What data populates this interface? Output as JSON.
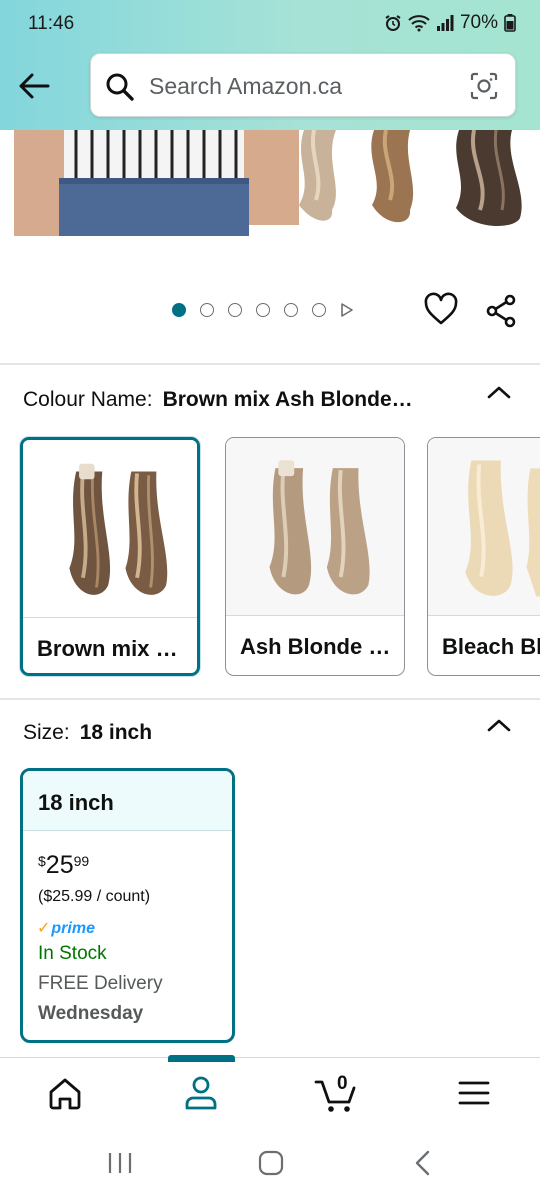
{
  "status_bar": {
    "time": "11:46",
    "battery": "70%"
  },
  "header": {
    "search_placeholder": "Search Amazon.ca"
  },
  "carousel": {
    "dots": 6,
    "active_index": 0
  },
  "colour": {
    "label": "Colour Name:",
    "selected_value": "Brown mix Ash Blonde…",
    "options": [
      {
        "name": "Brown mix …",
        "selected": true
      },
      {
        "name": "Ash Blonde …",
        "selected": false
      },
      {
        "name": "Bleach Bl",
        "selected": false
      }
    ]
  },
  "size": {
    "label": "Size:",
    "selected_value": "18 inch",
    "card": {
      "title": "18 inch",
      "currency": "$",
      "price_whole": "25",
      "price_fraction": "99",
      "unit_price": "($25.99 / count)",
      "prime": "prime",
      "stock": "In Stock",
      "delivery_line1": "FREE Delivery",
      "delivery_line2": "Wednesday"
    }
  },
  "bottom_nav": {
    "cart_count": "0",
    "active": "account"
  },
  "colors": {
    "accent": "#007185",
    "in_stock": "#007600",
    "prime": "#1a98ff"
  }
}
